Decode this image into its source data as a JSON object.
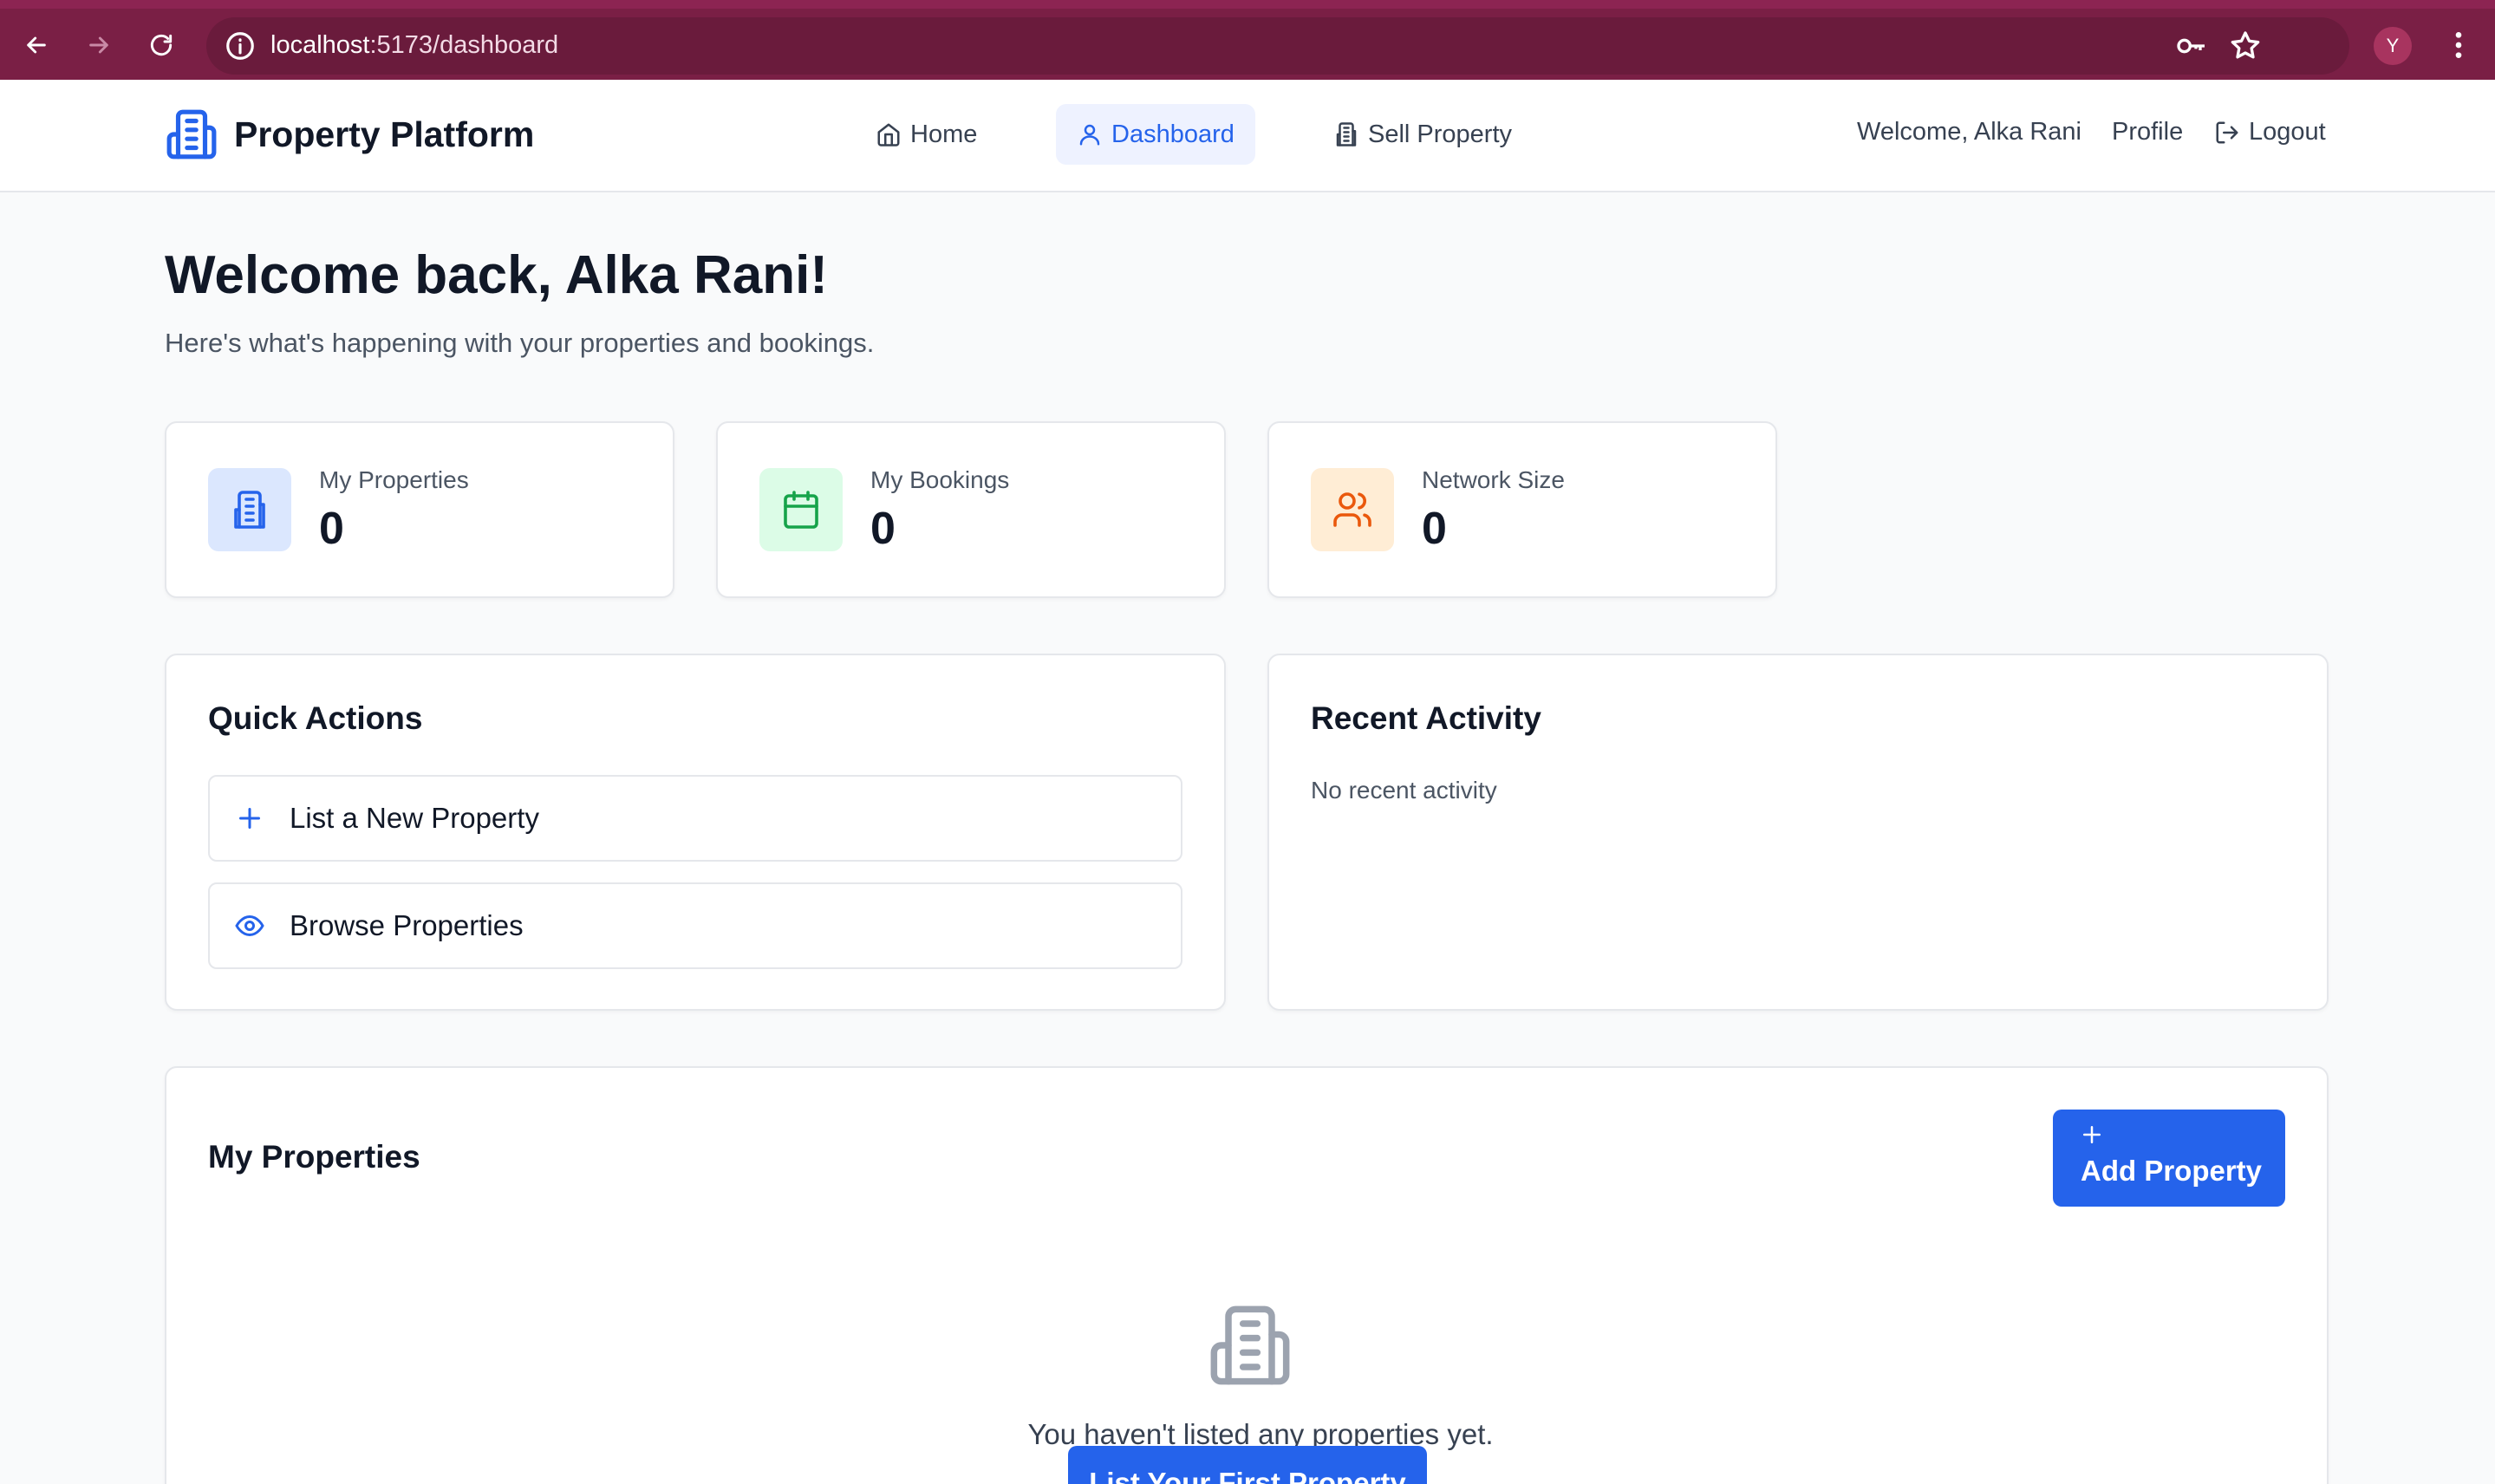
{
  "browser": {
    "url_host": "localhost",
    "url_path": ":5173/dashboard",
    "profile_initial": "Y",
    "theme_color": "#7a1f45"
  },
  "header": {
    "brand": "Property Platform",
    "nav": {
      "home": "Home",
      "dashboard": "Dashboard",
      "sell": "Sell Property"
    },
    "welcome": "Welcome, Alka Rani",
    "profile": "Profile",
    "logout": "Logout",
    "active_tab": "Dashboard"
  },
  "page": {
    "title": "Welcome back, Alka Rani!",
    "subtitle": "Here's what's happening with your properties and bookings."
  },
  "stats": [
    {
      "label": "My Properties",
      "value": "0",
      "icon": "building-icon",
      "color": "#2563eb",
      "bg": "#dbe7fe"
    },
    {
      "label": "My Bookings",
      "value": "0",
      "icon": "calendar-icon",
      "color": "#16a34a",
      "bg": "#dcfce7"
    },
    {
      "label": "Network Size",
      "value": "0",
      "icon": "users-icon",
      "color": "#ea580c",
      "bg": "#ffedd5"
    }
  ],
  "quick_actions": {
    "title": "Quick Actions",
    "items": [
      {
        "label": "List a New Property",
        "icon": "plus-icon"
      },
      {
        "label": "Browse Properties",
        "icon": "eye-icon"
      }
    ]
  },
  "recent_activity": {
    "title": "Recent Activity",
    "empty": "No recent activity"
  },
  "my_properties": {
    "title": "My Properties",
    "add_button": "Add Property",
    "empty_text": "You haven't listed any properties yet.",
    "first_button": "List Your First Property"
  },
  "colors": {
    "primary": "#2563eb",
    "background": "#f9fafb",
    "border": "#e5e7eb"
  }
}
